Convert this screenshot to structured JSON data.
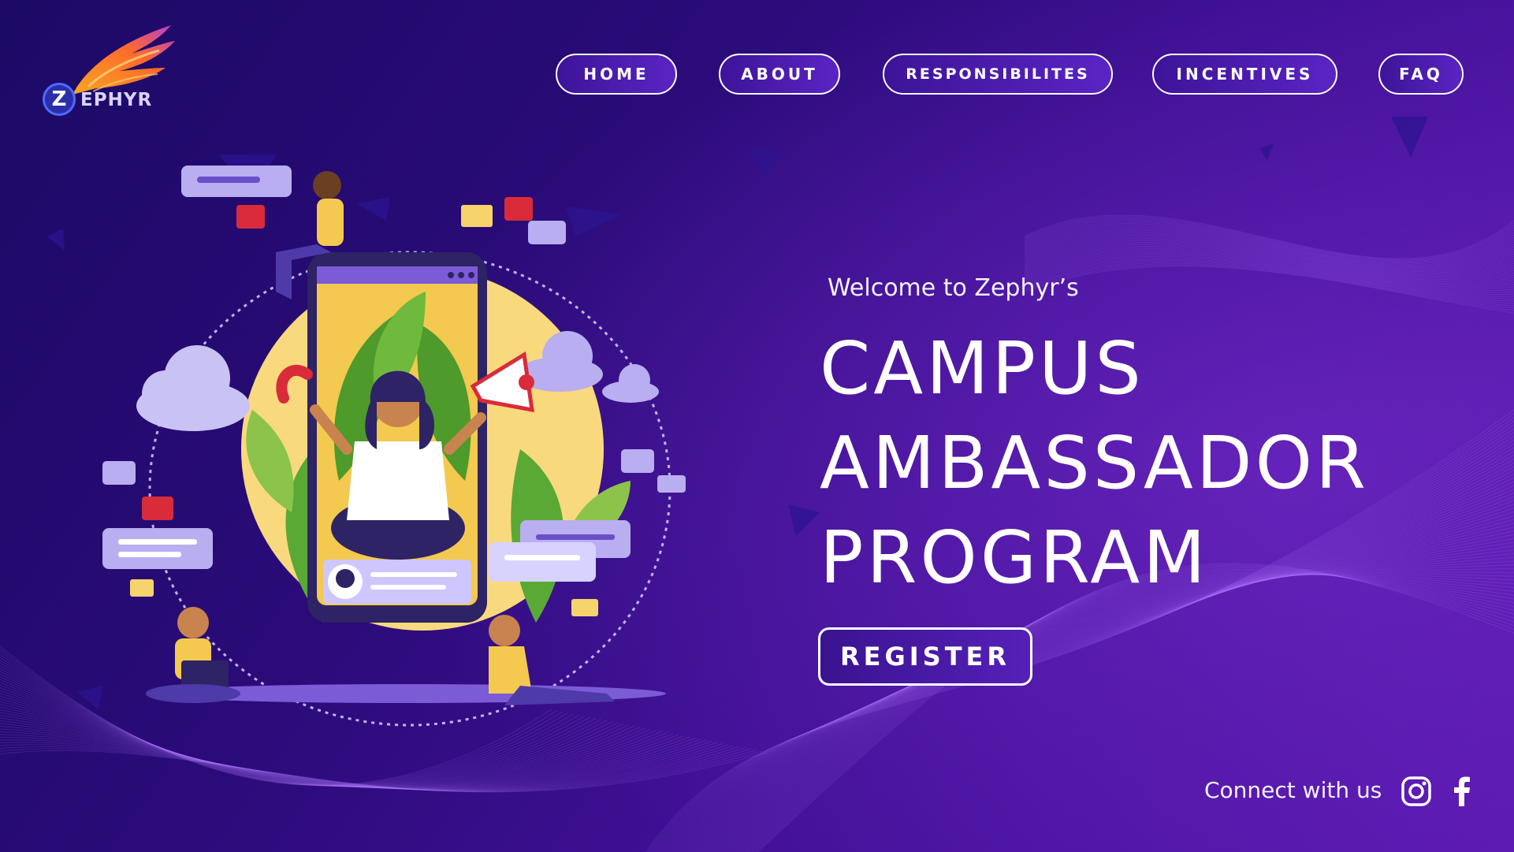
{
  "brand": {
    "logo_text": "EPHYR",
    "logo_letter": "Z"
  },
  "nav": {
    "items": [
      {
        "label": "HOME"
      },
      {
        "label": "ABOUT"
      },
      {
        "label": "RESPONSIBILITES"
      },
      {
        "label": "INCENTIVES"
      },
      {
        "label": "FAQ"
      }
    ]
  },
  "hero": {
    "welcome": "Welcome to Zephyr’s",
    "title_lines": [
      "CAMPUS",
      "AMBASSADOR",
      "PROGRAM"
    ],
    "register_label": "REGISTER"
  },
  "footer": {
    "connect_label": "Connect with us",
    "social": [
      {
        "icon": "instagram-icon"
      },
      {
        "icon": "facebook-icon"
      }
    ]
  },
  "colors": {
    "bg_dark": "#1c0a66",
    "bg_light": "#5a18b0",
    "accent_purple": "#6a3fd0",
    "sun_yellow": "#f6d36b",
    "button_border": "#ffffff"
  }
}
